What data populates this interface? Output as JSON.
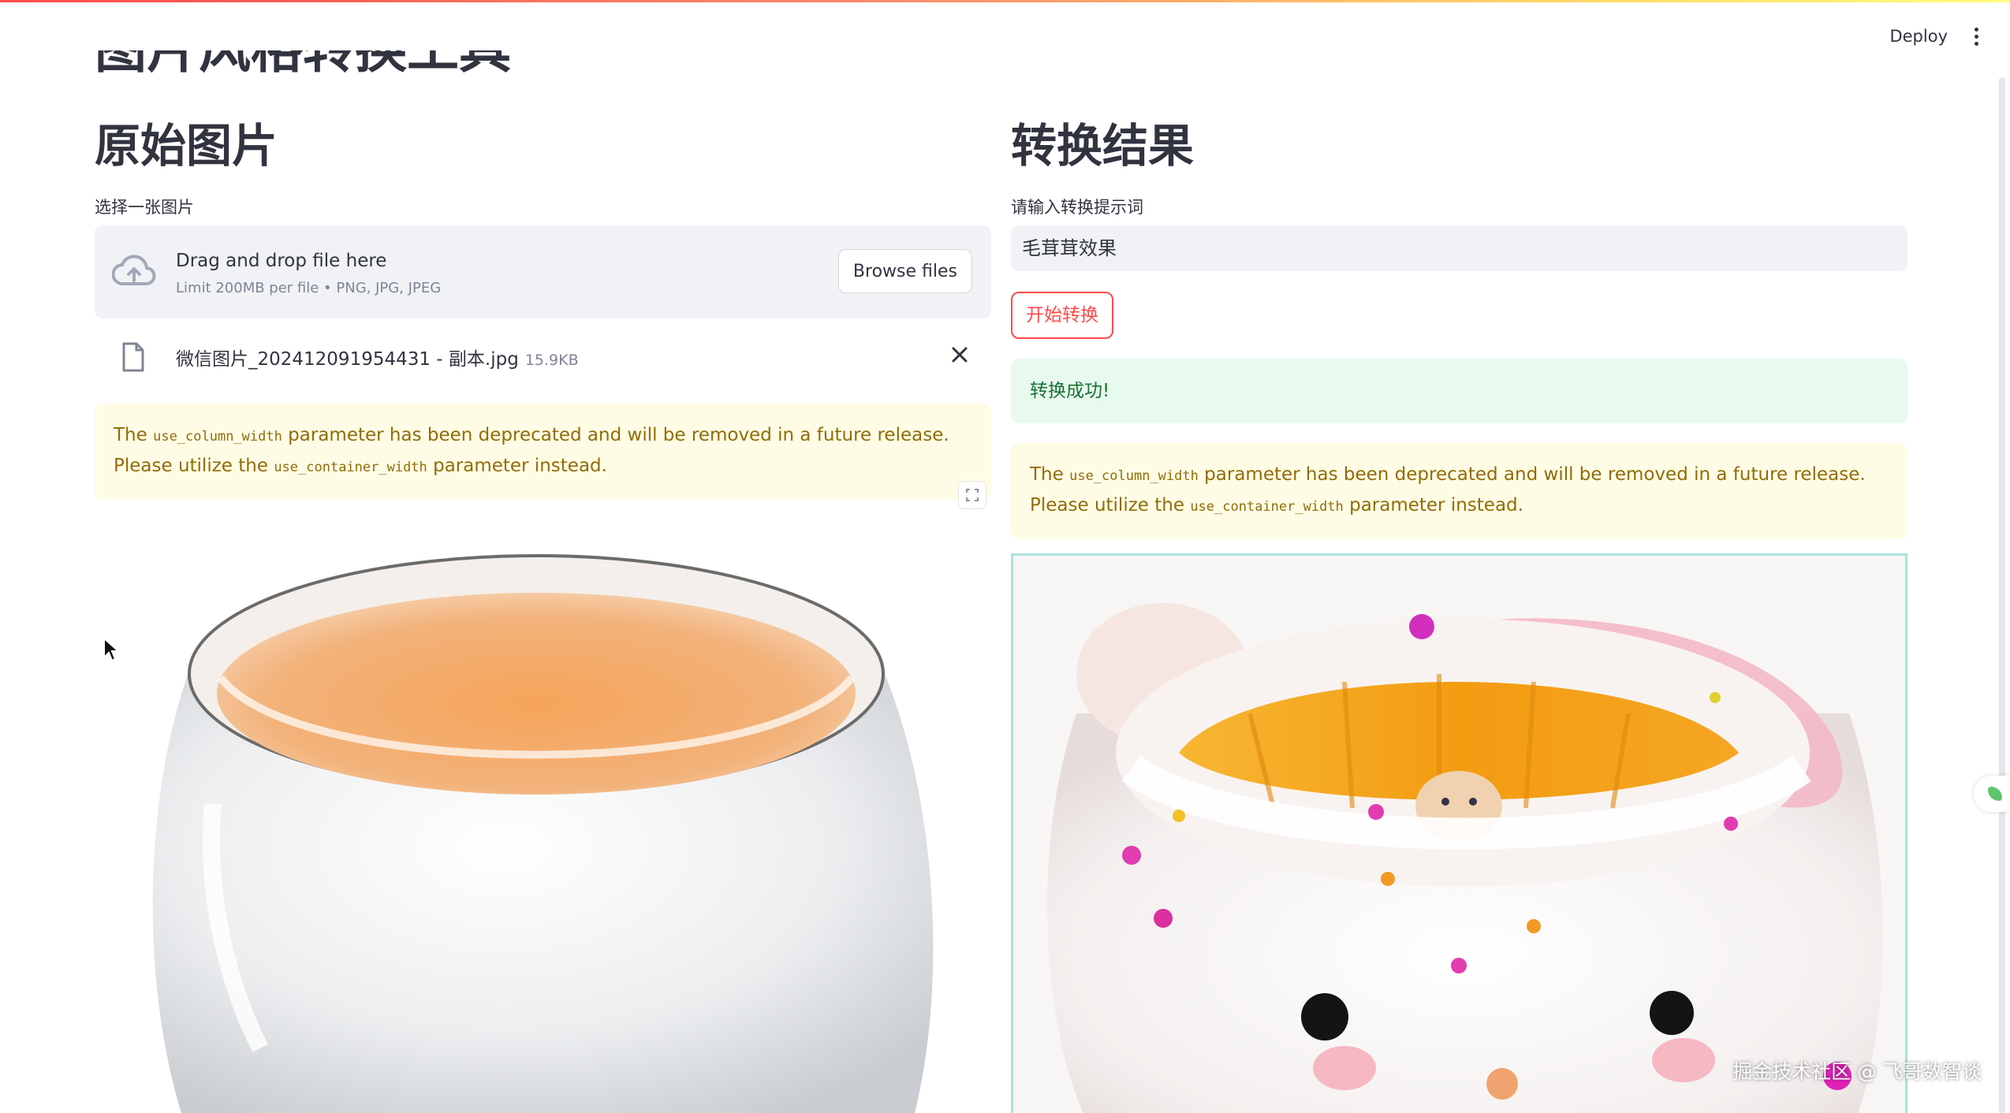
{
  "header": {
    "deploy_label": "Deploy"
  },
  "page_title": "图片风格转换工具",
  "left": {
    "heading": "原始图片",
    "uploader_label": "选择一张图片",
    "dropzone_main": "Drag and drop file here",
    "dropzone_sub": "Limit 200MB per file • PNG, JPG, JPEG",
    "browse_label": "Browse files",
    "file_name": "微信图片_202412091954431 - 副本.jpg",
    "file_size": "15.9KB",
    "warning": {
      "pre": "The ",
      "code1": "use_column_width",
      "mid": " parameter has been deprecated and will be removed in a future release. Please utilize the ",
      "code2": "use_container_width",
      "post": " parameter instead."
    }
  },
  "right": {
    "heading": "转换结果",
    "prompt_label": "请输入转换提示词",
    "prompt_value": "毛茸茸效果",
    "run_label": "开始转换",
    "success": "转换成功!",
    "warning": {
      "pre": "The ",
      "code1": "use_column_width",
      "mid": " parameter has been deprecated and will be removed in a future release. Please utilize the ",
      "code2": "use_container_width",
      "post": " parameter instead."
    }
  },
  "watermark": "掘金技术社区 @ 飞哥数智谈",
  "colors": {
    "primary": "#ff4b4b",
    "warning_bg": "#fffce6",
    "warning_text": "#926c05",
    "success_bg": "#e8f9ee",
    "success_text": "#177233"
  },
  "icons": [
    "cloud-upload-icon",
    "file-icon",
    "close-icon",
    "fullscreen-icon",
    "more-vert-icon",
    "cursor-icon"
  ]
}
